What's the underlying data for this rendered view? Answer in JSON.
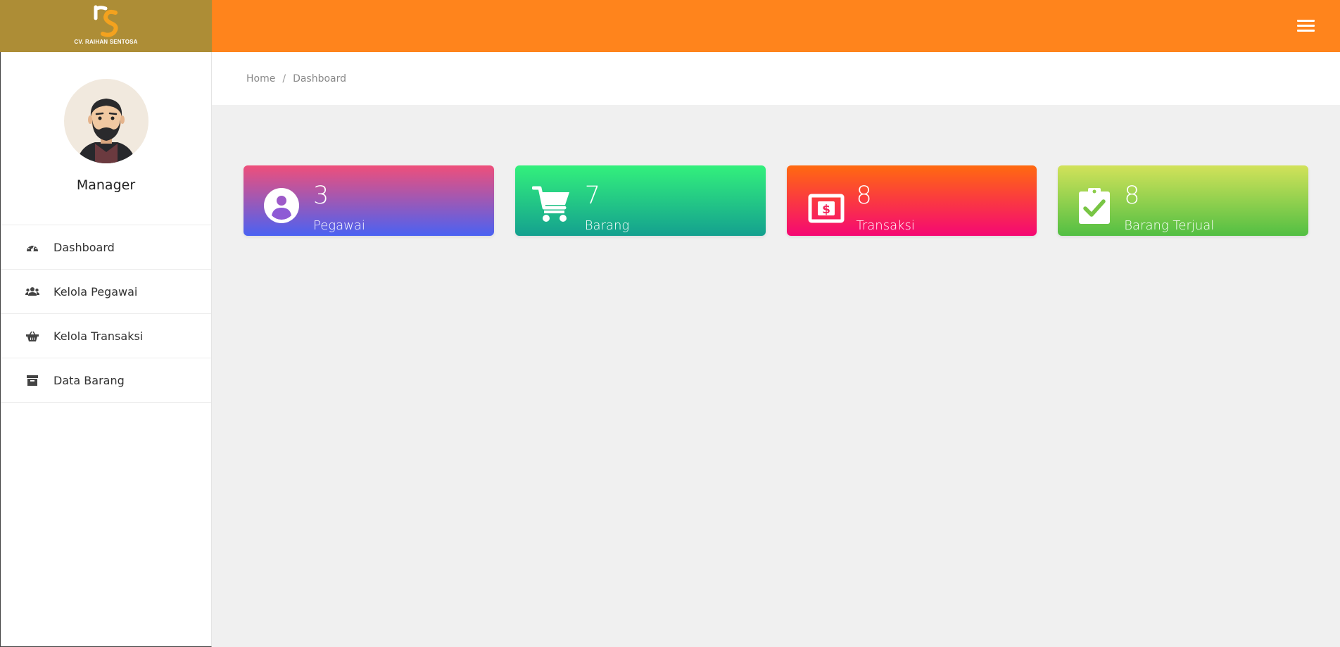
{
  "brand": {
    "name": "CV. RAIHAN SENTOSA",
    "logo_icon": "rs-logo-icon"
  },
  "topbar": {
    "menu_icon": "hamburger-icon",
    "background": "#ff841c"
  },
  "sidebar": {
    "profile": {
      "role": "Manager",
      "avatar_icon": "bearded-man-avatar"
    },
    "items": [
      {
        "label": "Dashboard",
        "icon": "tachometer-icon"
      },
      {
        "label": "Kelola Pegawai",
        "icon": "users-icon"
      },
      {
        "label": "Kelola Transaksi",
        "icon": "basket-icon"
      },
      {
        "label": "Data Barang",
        "icon": "archive-icon"
      }
    ]
  },
  "breadcrumb": {
    "home": "Home",
    "separator": "/",
    "current": "Dashboard"
  },
  "cards": [
    {
      "value": "3",
      "label": "Pegawai",
      "icon": "user-circle-icon"
    },
    {
      "value": "7",
      "label": "Barang",
      "icon": "shopping-cart-icon"
    },
    {
      "value": "8",
      "label": "Transaksi",
      "icon": "money-bill-icon"
    },
    {
      "value": "8",
      "label": "Barang Terjual",
      "icon": "clipboard-check-icon"
    }
  ]
}
